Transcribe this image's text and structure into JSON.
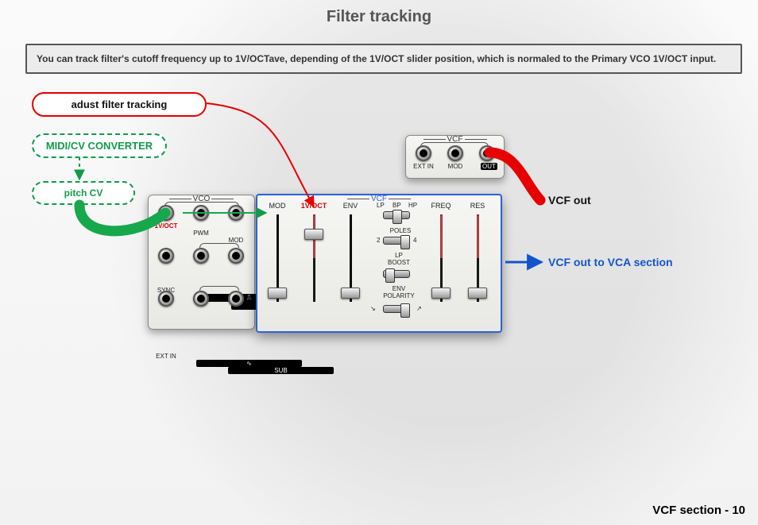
{
  "title": "Filter tracking",
  "info_text": "You can track filter's cutoff frequency up to 1V/OCTave, depending of the 1V/OCT slider position, which is normaled to the Primary VCO 1V/OCT input.",
  "callouts": {
    "adjust": "adust filter tracking",
    "midi_cv": "MIDI/CV CONVERTER",
    "pitch_cv": "pitch CV"
  },
  "labels": {
    "vcf_out": "VCF out",
    "vcf_to_vca": "VCF out to VCA section"
  },
  "footer": {
    "section": "VCF section - ",
    "page": "10"
  },
  "vco": {
    "title": "VCO",
    "jacks": {
      "r1": [
        "1V/OCT",
        "PWM",
        "MOD"
      ],
      "r2": [
        "SYNC",
        "⎍",
        "𝄐"
      ],
      "r3": [
        "EXT IN",
        "∿",
        "SUB"
      ]
    }
  },
  "vcf_jacks": {
    "title": "VCF",
    "jacks": [
      "EXT IN",
      "MOD",
      "OUT"
    ]
  },
  "vcf": {
    "title": "VCF",
    "sliders": [
      "MOD",
      "1V/OCT",
      "ENV",
      "FREQ",
      "RES"
    ],
    "center": {
      "filter_types": [
        "LP",
        "BP",
        "HP"
      ],
      "poles_label": "POLES",
      "poles_values": [
        "2",
        "4"
      ],
      "lp_boost": "LP\nBOOST",
      "env_polarity": "ENV\nPOLARITY"
    }
  }
}
